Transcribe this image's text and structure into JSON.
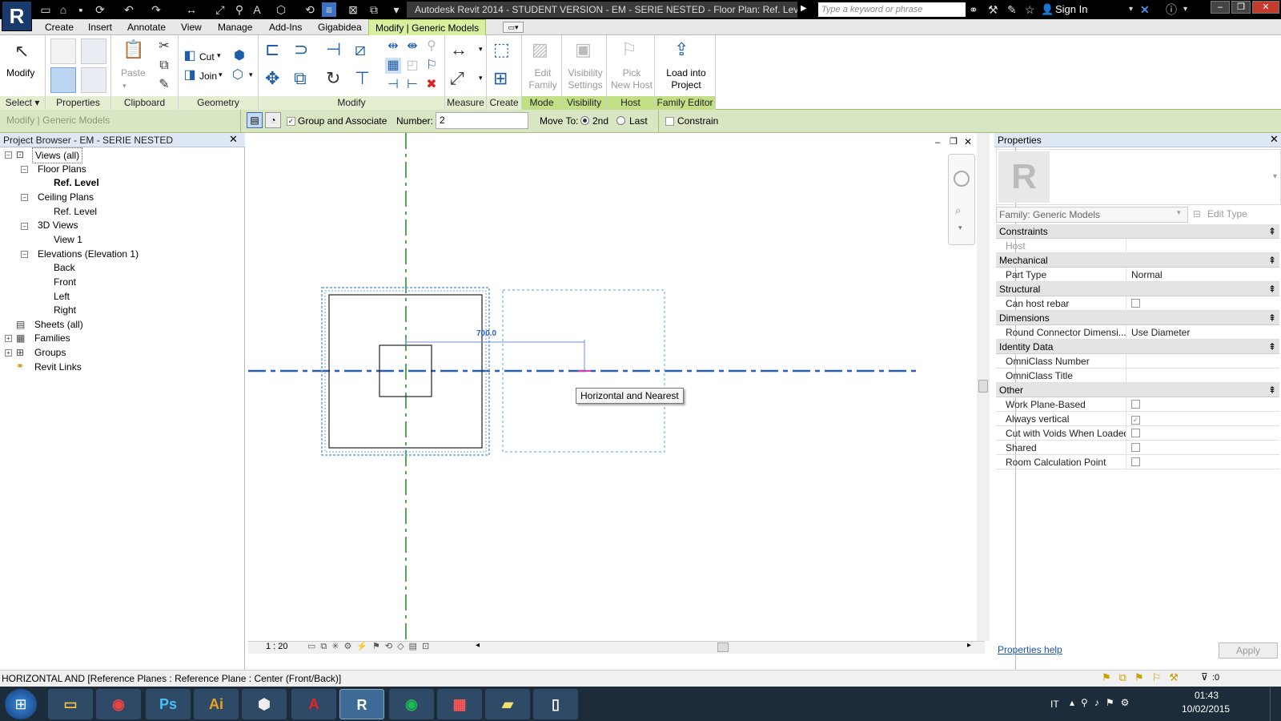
{
  "window": {
    "title": "Autodesk Revit 2014 - STUDENT VERSION -    EM - SERIE NESTED - Floor Plan: Ref. Level",
    "search_placeholder": "Type a keyword or phrase",
    "sign_in": "Sign In",
    "app_letter": "R"
  },
  "ribbon_tabs": [
    "Create",
    "Insert",
    "Annotate",
    "View",
    "Manage",
    "Add-Ins",
    "Gigabidea",
    "Modify | Generic Models"
  ],
  "ribbon": {
    "modify": "Modify",
    "cut": "Cut",
    "join": "Join",
    "paste": "Paste",
    "edit_family": [
      "Edit",
      "Family"
    ],
    "visibility_settings": [
      "Visibility",
      "Settings"
    ],
    "pick_new_host": [
      "Pick",
      "New Host"
    ],
    "load_into_project": [
      "Load into",
      "Project"
    ],
    "panels": [
      "Select",
      "Properties",
      "Clipboard",
      "Geometry",
      "Modify",
      "Measure",
      "Create",
      "Mode",
      "Visibility",
      "Host",
      "Family Editor"
    ]
  },
  "optbar": {
    "context": "Modify | Generic Models",
    "group_associate": "Group and Associate",
    "number_label": "Number:",
    "number_value": "2",
    "move_to": "Move To:",
    "opt_2nd": "2nd",
    "opt_last": "Last",
    "constrain": "Constrain"
  },
  "project_browser": {
    "title": "Project Browser - EM - SERIE NESTED",
    "items": [
      "Views (all)",
      "Floor Plans",
      "Ref. Level",
      "Ceiling Plans",
      "Ref. Level",
      "3D Views",
      "View 1",
      "Elevations (Elevation 1)",
      "Back",
      "Front",
      "Left",
      "Right",
      "Sheets (all)",
      "Families",
      "Groups",
      "Revit Links"
    ]
  },
  "canvas": {
    "dimension": "700.0",
    "tooltip": "Horizontal and Nearest",
    "scale": "1 : 20"
  },
  "properties": {
    "title": "Properties",
    "family": "Family: Generic Models",
    "edit_type": "Edit Type",
    "sections": {
      "constraints": "Constraints",
      "mechanical": "Mechanical",
      "structural": "Structural",
      "dimensions": "Dimensions",
      "identity": "Identity Data",
      "other": "Other"
    },
    "rows": {
      "host": "Host",
      "part_type": "Part Type",
      "part_type_value": "Normal",
      "can_host_rebar": "Can host rebar",
      "round_connector": "Round Connector Dimensi...",
      "round_connector_value": "Use Diameter",
      "omniclass_number": "OmniClass Number",
      "omniclass_title": "OmniClass Title",
      "work_plane_based": "Work Plane-Based",
      "always_vertical": "Always vertical",
      "cut_with_voids": "Cut with Voids When Loaded",
      "shared": "Shared",
      "room_calc_point": "Room Calculation Point"
    },
    "help": "Properties help",
    "apply": "Apply"
  },
  "statusbar": {
    "text": "HORIZONTAL AND [Reference Planes : Reference Plane : Center (Front/Back)]",
    "filter_count": ":0"
  },
  "taskbar": {
    "lang": "IT",
    "time": "01:43",
    "date": "10/02/2015"
  },
  "colors": {
    "ribbon_context": "#d7ef9e",
    "options_bar": "#d9e6c3",
    "ref_plane_vertical": "#1e8a1e",
    "ref_plane_horizontal": "#2a5fb0",
    "dimension": "#2b5fd0"
  }
}
